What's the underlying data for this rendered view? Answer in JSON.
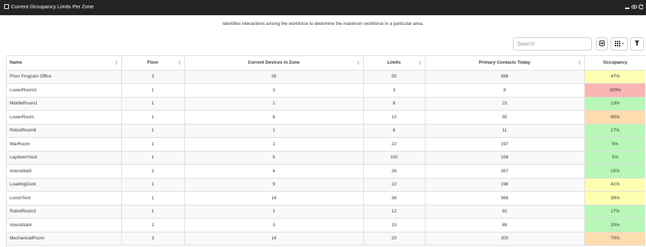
{
  "window": {
    "title": "Current Occupancy Limits Per Zone"
  },
  "description": "Identifies interactions among the workforce to determine the maximum workforce in a particular area.",
  "search": {
    "placeholder": "Search"
  },
  "columns": [
    "Name",
    "Floor",
    "Current Devices in Zone",
    "Limits",
    "Primary Contacts Today",
    "Occupancy"
  ],
  "rows": [
    {
      "name": "Floor Program Office",
      "floor": "3",
      "devices": "26",
      "limits": "55",
      "contacts": "586",
      "occupancy": "47%",
      "level": "yellow"
    },
    {
      "name": "LowerRoom3",
      "floor": "1",
      "devices": "3",
      "limits": "3",
      "contacts": "8",
      "occupancy": "100%",
      "level": "red"
    },
    {
      "name": "MiddleRoom1",
      "floor": "1",
      "devices": "1",
      "limits": "8",
      "contacts": "23",
      "occupancy": "13%",
      "level": "green"
    },
    {
      "name": "LowerRoom",
      "floor": "1",
      "devices": "6",
      "limits": "10",
      "contacts": "55",
      "occupancy": "60%",
      "level": "orange"
    },
    {
      "name": "RobotRoom6",
      "floor": "1",
      "devices": "1",
      "limits": "6",
      "contacts": "11",
      "occupancy": "17%",
      "level": "green"
    },
    {
      "name": "WarRoom",
      "floor": "1",
      "devices": "1",
      "limits": "22",
      "contacts": "197",
      "occupancy": "5%",
      "level": "green"
    },
    {
      "name": "LaydownYard",
      "floor": "1",
      "devices": "5",
      "limits": "100",
      "contacts": "158",
      "occupancy": "5%",
      "level": "green"
    },
    {
      "name": "Interstitial3",
      "floor": "2",
      "devices": "4",
      "limits": "26",
      "contacts": "267",
      "occupancy": "15%",
      "level": "green"
    },
    {
      "name": "LoadingDock",
      "floor": "1",
      "devices": "9",
      "limits": "22",
      "contacts": "196",
      "occupancy": "41%",
      "level": "yellow"
    },
    {
      "name": "LunchTent",
      "floor": "1",
      "devices": "14",
      "limits": "36",
      "contacts": "566",
      "occupancy": "39%",
      "level": "yellow"
    },
    {
      "name": "RobotRoom2",
      "floor": "1",
      "devices": "2",
      "limits": "12",
      "contacts": "92",
      "occupancy": "17%",
      "level": "green"
    },
    {
      "name": "Interstitial4",
      "floor": "2",
      "devices": "3",
      "limits": "15",
      "contacts": "89",
      "occupancy": "20%",
      "level": "green"
    },
    {
      "name": "MechanicalRoom",
      "floor": "3",
      "devices": "14",
      "limits": "20",
      "contacts": "200",
      "occupancy": "70%",
      "level": "orange"
    }
  ],
  "colors": {
    "titlebar": "#232323",
    "occupancy_yellow": "#fefeb2",
    "occupancy_red": "#f9b4b4",
    "occupancy_green": "#b8f7b8",
    "occupancy_orange": "#fddcb0"
  },
  "icons": {
    "title": "window-icon",
    "controls": [
      "minimize-icon",
      "visibility-icon",
      "refresh-icon"
    ],
    "toolbar": [
      "toggle-view-icon",
      "columns-grid-icon",
      "filter-icon"
    ]
  }
}
